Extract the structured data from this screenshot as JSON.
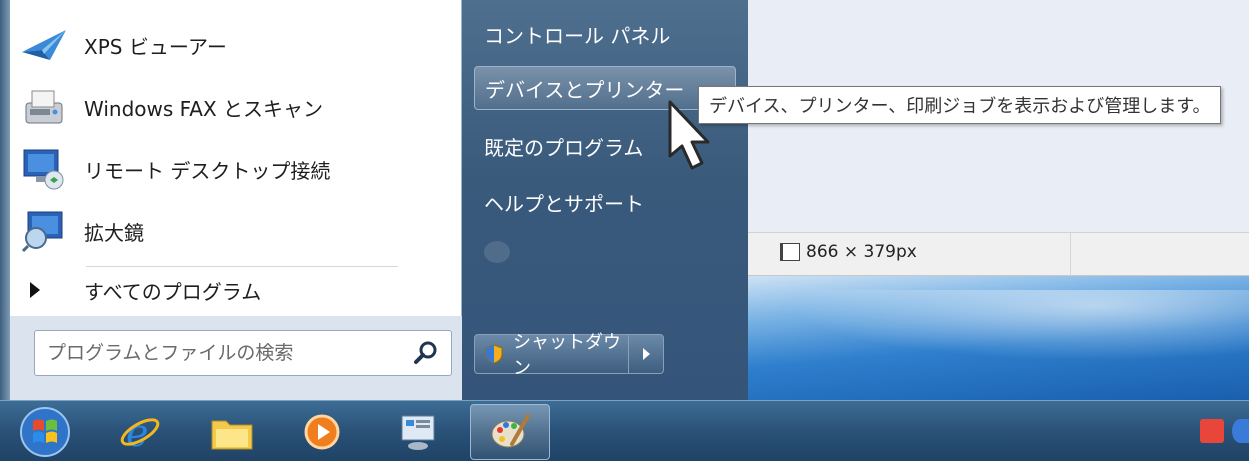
{
  "start_menu": {
    "programs": [
      {
        "label": "XPS ビューアー",
        "icon": "xps-viewer-icon"
      },
      {
        "label": "Windows FAX とスキャン",
        "icon": "fax-scan-icon"
      },
      {
        "label": "リモート デスクトップ接続",
        "icon": "remote-desktop-icon"
      },
      {
        "label": "拡大鏡",
        "icon": "magnifier-icon"
      }
    ],
    "all_programs_label": "すべてのプログラム",
    "search_placeholder": "プログラムとファイルの検索",
    "right_items": [
      {
        "label": "コントロール パネル"
      },
      {
        "label": "デバイスとプリンター"
      },
      {
        "label": "既定のプログラム"
      },
      {
        "label": "ヘルプとサポート"
      }
    ],
    "shutdown_label": "シャットダウン"
  },
  "tooltip": {
    "text": "デバイス、プリンター、印刷ジョブを表示および管理します。"
  },
  "paint_status": {
    "canvas_size": "866 × 379px"
  },
  "taskbar": {
    "items": [
      "start-orb-icon",
      "internet-explorer-icon",
      "file-explorer-icon",
      "media-player-icon",
      "remote-desktop-icon",
      "paint-icon"
    ],
    "tray": [
      "app-tray-icon",
      "help-tray-icon"
    ]
  },
  "colors": {
    "start_right_pane": "#3a5a7c",
    "taskbar": "#2a5177",
    "accent": "#1a5fae"
  }
}
